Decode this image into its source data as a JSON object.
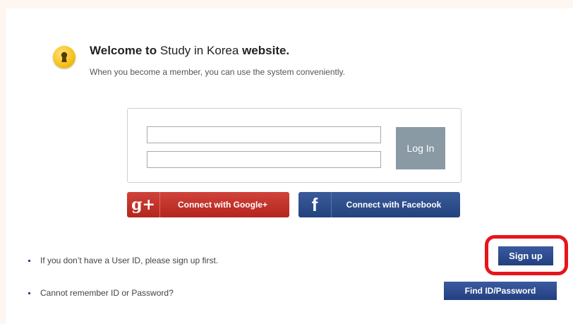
{
  "header": {
    "welcome_prefix": "Welcome to",
    "site_name": "Study in Korea",
    "welcome_suffix": "website.",
    "subtitle": "When you become a member, you can use the system conveniently."
  },
  "login": {
    "user_id_value": "",
    "password_value": "",
    "login_label": "Log In"
  },
  "social": {
    "google_icon_text": "g+",
    "google_label": "Connect with Google+",
    "facebook_icon_text": "f",
    "facebook_label": "Connect with Facebook"
  },
  "help": {
    "signup_text": "If you don’t have a User ID, please sign up first.",
    "signup_label": "Sign up",
    "forgot_text": "Cannot remember ID or Password?",
    "find_label": "Find ID/Password"
  },
  "colors": {
    "page_bg": "#fdf6f1",
    "google_red": "#c1312a",
    "facebook_blue": "#2f4d8c",
    "button_blue": "#2d4b8e",
    "highlight_red": "#e8141c",
    "login_grey": "#8a9aa4"
  },
  "icons": {
    "welcome_icon": "keyhole-icon"
  }
}
